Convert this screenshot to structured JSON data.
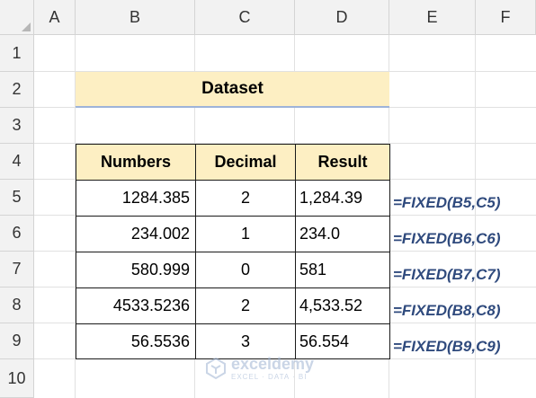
{
  "columns": [
    "A",
    "B",
    "C",
    "D",
    "E",
    "F"
  ],
  "rows": [
    "1",
    "2",
    "3",
    "4",
    "5",
    "6",
    "7",
    "8",
    "9",
    "10"
  ],
  "title": "Dataset",
  "table": {
    "headers": [
      "Numbers",
      "Decimal",
      "Result"
    ],
    "rows": [
      {
        "number": "1284.385",
        "decimal": "2",
        "result": "1,284.39",
        "formula": "=FIXED(B5,C5)"
      },
      {
        "number": "234.002",
        "decimal": "1",
        "result": "234.0",
        "formula": "=FIXED(B6,C6)"
      },
      {
        "number": "580.999",
        "decimal": "0",
        "result": "581",
        "formula": "=FIXED(B7,C7)"
      },
      {
        "number": "4533.5236",
        "decimal": "2",
        "result": "4,533.52",
        "formula": "=FIXED(B8,C8)"
      },
      {
        "number": "56.5536",
        "decimal": "3",
        "result": "56.554",
        "formula": "=FIXED(B9,C9)"
      }
    ]
  },
  "watermark": {
    "brand": "exceldemy",
    "tagline": "EXCEL · DATA · BI"
  },
  "colors": {
    "header_fill": "#fdefc3",
    "title_underline": "#9db3d9",
    "formula_text": "#2f4a7d"
  }
}
